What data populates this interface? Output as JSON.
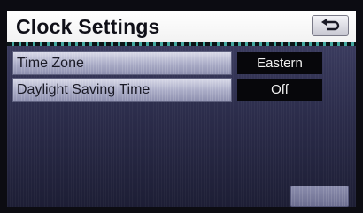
{
  "header": {
    "title": "Clock Settings",
    "back_icon": "return-arrow-icon"
  },
  "settings": [
    {
      "label": "Time Zone",
      "value": "Eastern"
    },
    {
      "label": "Daylight Saving Time",
      "value": "Off"
    }
  ],
  "colors": {
    "header_bg": "#ffffff",
    "divider_accent": "#43a8a0",
    "panel_bg": "#2b2c4a",
    "row_bg": "#a9abc6",
    "value_bg": "#07070b"
  }
}
